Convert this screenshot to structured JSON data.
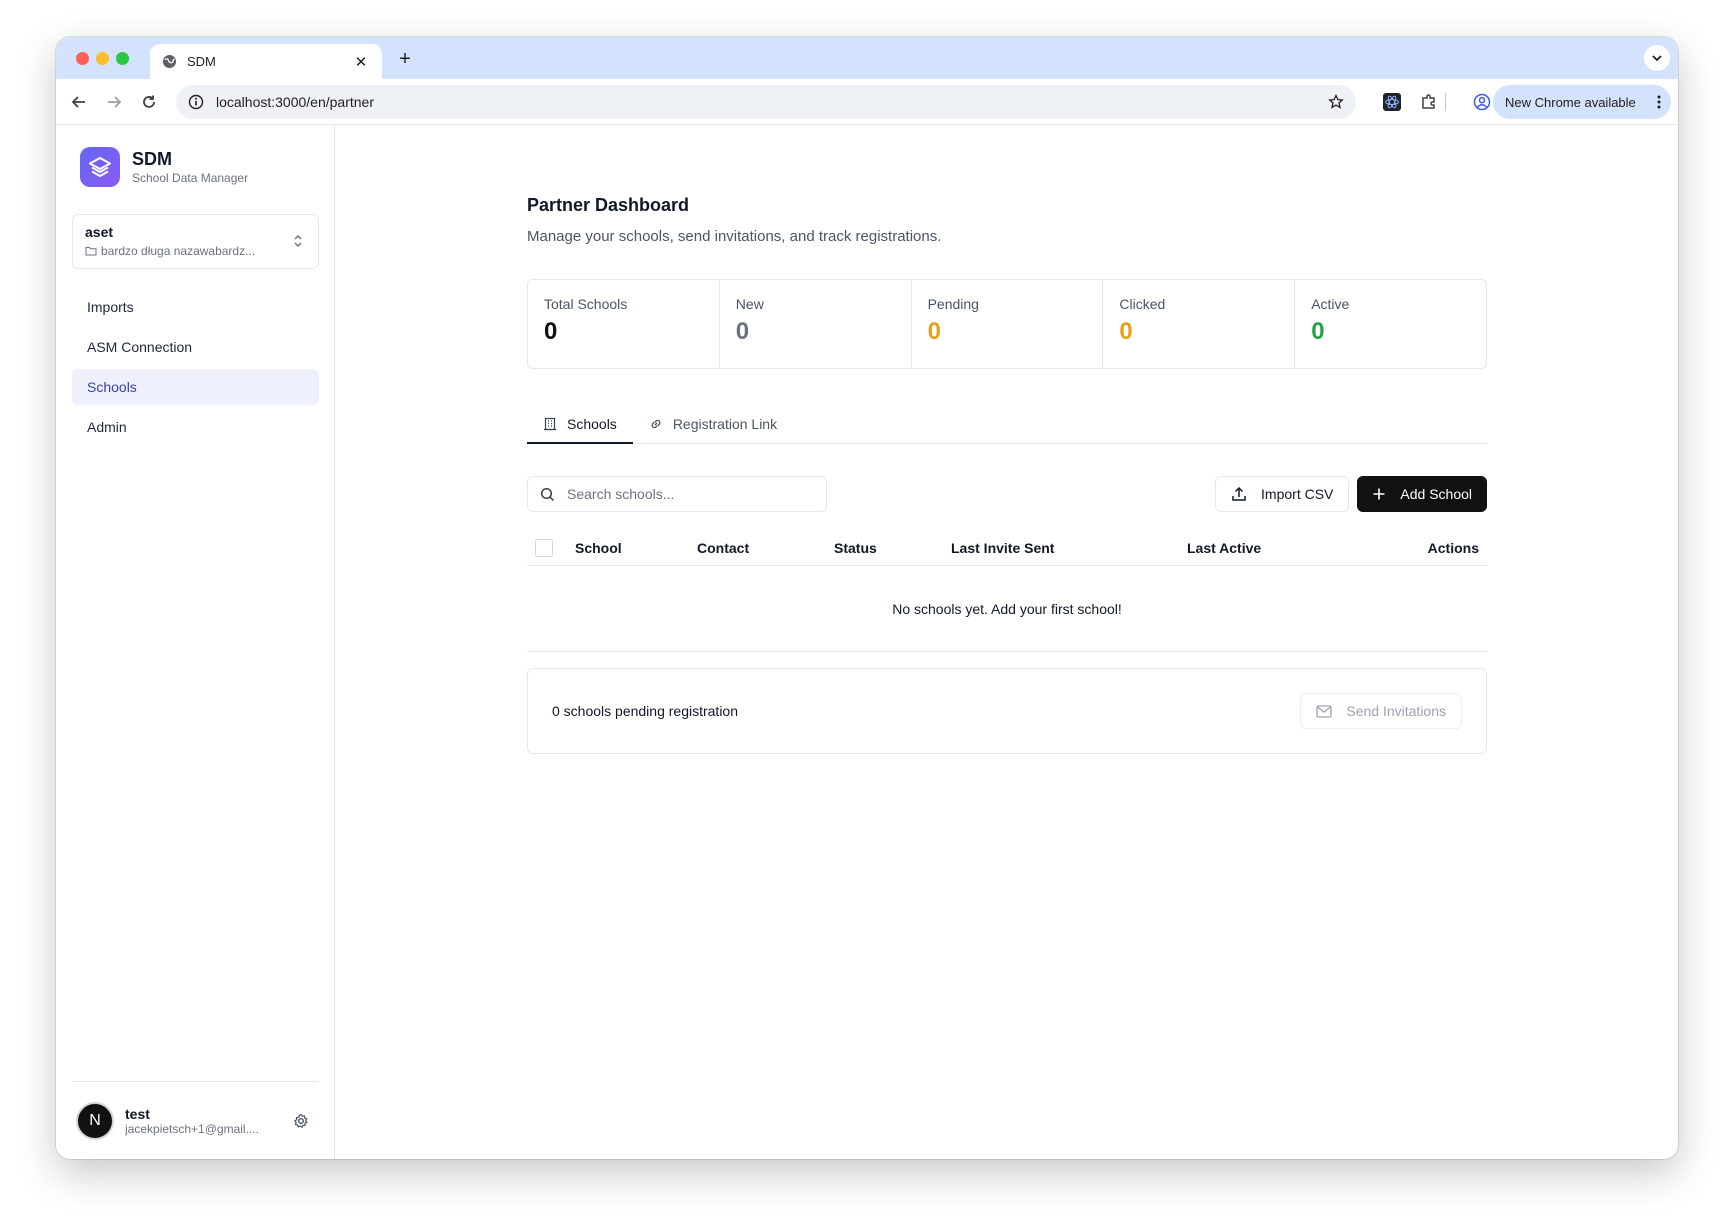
{
  "browser": {
    "tab_title": "SDM",
    "tab_close": "✕",
    "new_tab": "+",
    "url": "localhost:3000/en/partner",
    "update_label": "New Chrome available"
  },
  "sidebar": {
    "brand_name": "SDM",
    "brand_subtitle": "School Data Manager",
    "workspace_name": "aset",
    "workspace_path": "bardzo długa nazawabardz...",
    "items": [
      {
        "label": "Imports"
      },
      {
        "label": "ASM Connection"
      },
      {
        "label": "Schools"
      },
      {
        "label": "Admin"
      }
    ],
    "user": {
      "initial": "N",
      "name": "test",
      "email": "jacekpietsch+1@gmail...."
    }
  },
  "main": {
    "title": "Partner Dashboard",
    "subtitle": "Manage your schools, send invitations, and track registrations.",
    "stats": [
      {
        "label": "Total Schools",
        "value": "0",
        "color": "#111111"
      },
      {
        "label": "New",
        "value": "0",
        "color": "#6b7280"
      },
      {
        "label": "Pending",
        "value": "0",
        "color": "#e2a21b"
      },
      {
        "label": "Clicked",
        "value": "0",
        "color": "#e2a21b"
      },
      {
        "label": "Active",
        "value": "0",
        "color": "#22a447"
      }
    ],
    "tabs": [
      {
        "label": "Schools"
      },
      {
        "label": "Registration Link"
      }
    ],
    "search_placeholder": "Search schools...",
    "import_label": "Import CSV",
    "add_label": "Add School",
    "table": {
      "columns": [
        "School",
        "Contact",
        "Status",
        "Last Invite Sent",
        "Last Active",
        "Actions"
      ],
      "empty_message": "No schools yet. Add your first school!"
    },
    "pending_text": "0 schools pending registration",
    "send_label": "Send Invitations"
  },
  "colors": {
    "accent": "#3b3f9e",
    "brand_gradient_start": "#6366f1",
    "brand_gradient_end": "#8b5cf6",
    "tab_bar": "#d3e3fd"
  }
}
